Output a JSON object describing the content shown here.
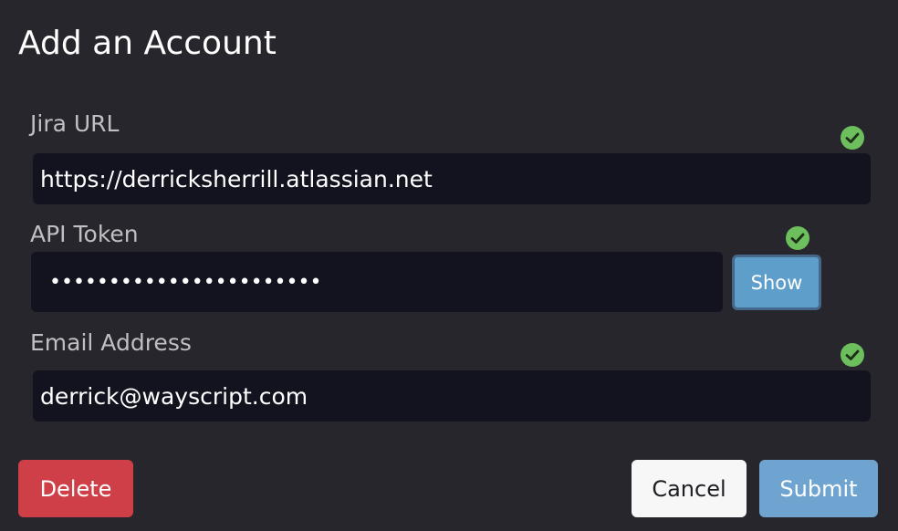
{
  "dialog": {
    "title": "Add an Account"
  },
  "fields": {
    "jira_url": {
      "label": "Jira URL",
      "value": "https://derricksherrill.atlassian.net",
      "valid": true
    },
    "api_token": {
      "label": "API Token",
      "value": "•••••••••••••••••••••••",
      "valid": true,
      "show_label": "Show"
    },
    "email": {
      "label": "Email Address",
      "value": "derrick@wayscript.com",
      "valid": true
    }
  },
  "actions": {
    "delete_label": "Delete",
    "cancel_label": "Cancel",
    "submit_label": "Submit"
  },
  "icons": {
    "valid": "check-circle-icon"
  },
  "colors": {
    "background": "#27262c",
    "input_background": "#131320",
    "valid_green": "#6cbf5c",
    "delete_red": "#cf3f48",
    "submit_blue": "#6ea4cf",
    "show_blue": "#5e9ecb"
  }
}
